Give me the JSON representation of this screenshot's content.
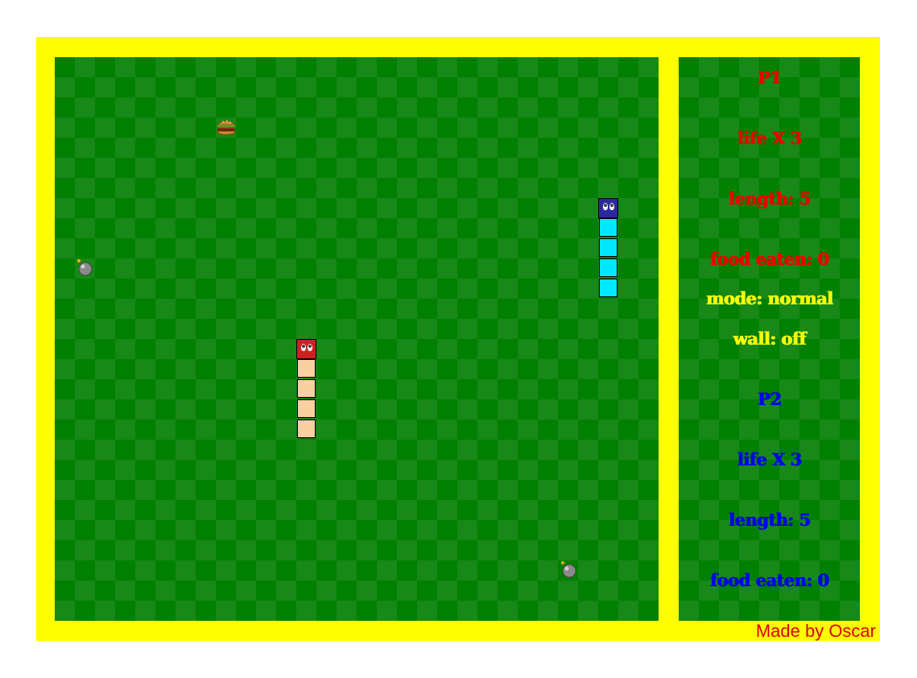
{
  "colors": {
    "frame": "#ffff00",
    "grass_dark": "#008000",
    "grass_light": "#188818",
    "p1": "#ee0000",
    "p2": "#0000ee",
    "info": "#ffff00",
    "snake1_head": "#cc2222",
    "snake1_body": "#f9d0a0",
    "snake2_head": "#2a2aa0",
    "snake2_body": "#00e8ff"
  },
  "board": {
    "grid_cols": 30,
    "grid_rows": 28,
    "items": {
      "food": "burger-icon",
      "hazard": "bomb-icon"
    }
  },
  "panel": {
    "p1": {
      "title": "P1",
      "life": "life X 3",
      "length": "length: 5",
      "food": "food eaten: 0"
    },
    "mode": "mode: normal",
    "wall": "wall: off",
    "p2": {
      "title": "P2",
      "life": "life X 3",
      "length": "length: 5",
      "food": "food eaten: 0"
    }
  },
  "credit": "Made by Oscar"
}
